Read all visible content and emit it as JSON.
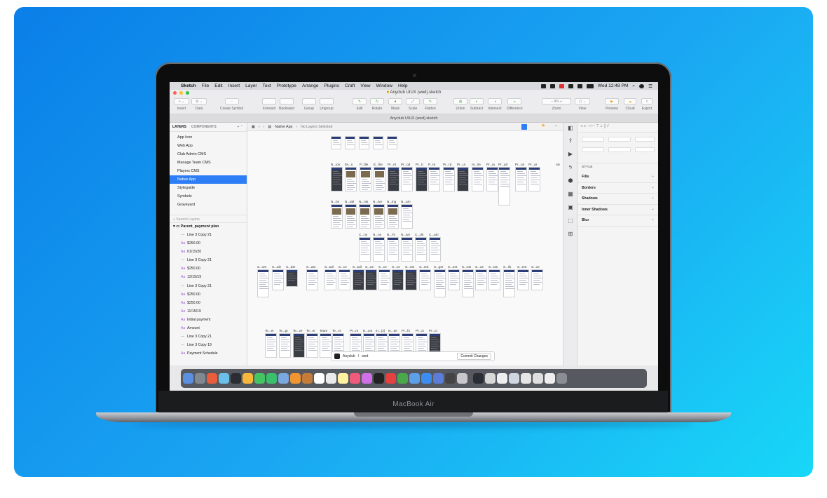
{
  "device": {
    "label": "MacBook Air"
  },
  "menubar": {
    "app": "Sketch",
    "items": [
      "File",
      "Edit",
      "Insert",
      "Layer",
      "Text",
      "Prototype",
      "Arrange",
      "Plugins",
      "Craft",
      "View",
      "Window",
      "Help"
    ],
    "clock": "Wed 12:48 PM"
  },
  "window": {
    "title": "Anyclub UIUX (wed).sketch",
    "tab": "Anyclub UIUX (wed).sketch"
  },
  "toolbar": {
    "insert": "Insert",
    "data": "Data",
    "create_symbol": "Create Symbol",
    "forward": "Forward",
    "backward": "Backward",
    "group": "Group",
    "ungroup": "Ungroup",
    "edit": "Edit",
    "rotate": "Rotate",
    "mask": "Mask",
    "scale": "Scale",
    "flatten": "Flatten",
    "union": "Union",
    "subtract": "Subtract",
    "intersect": "Intersect",
    "difference": "Difference",
    "zoom_label": "Zoom",
    "zoom_value": "8%",
    "view": "View",
    "preview": "Preview",
    "cloud": "Cloud",
    "export": "Export"
  },
  "layers_panel": {
    "tab_layers": "LAYERS",
    "tab_components": "COMPONENTS",
    "pages": [
      "App Icon",
      "Web App",
      "Club Admin CMS",
      "Manage Team CMS",
      "Players CMS",
      "Native App",
      "Styleguide",
      "Symbols",
      "Graveyard"
    ],
    "selected_page": "Native App",
    "search_placeholder": "Search Layers",
    "group_name": "Parent_payment plan",
    "layers": [
      {
        "kind": "line",
        "name": "Line 3 Copy 21"
      },
      {
        "kind": "text",
        "name": "$250.00"
      },
      {
        "kind": "text",
        "name": "01/15/20"
      },
      {
        "kind": "line",
        "name": "Line 3 Copy 21"
      },
      {
        "kind": "text",
        "name": "$250.00"
      },
      {
        "kind": "text",
        "name": "12/15/19"
      },
      {
        "kind": "line",
        "name": "Line 3 Copy 21"
      },
      {
        "kind": "text",
        "name": "$250.00"
      },
      {
        "kind": "text",
        "name": "$250.00"
      },
      {
        "kind": "text",
        "name": "11/15/19"
      },
      {
        "kind": "text",
        "name": "Initial payment"
      },
      {
        "kind": "text",
        "name": "Amount"
      },
      {
        "kind": "line",
        "name": "Line 3 Copy 21"
      },
      {
        "kind": "line",
        "name": "Line 3 Copy 19"
      },
      {
        "kind": "text",
        "name": "Payment Schedule"
      }
    ]
  },
  "canvas": {
    "breadcrumb_page": "Native App",
    "breadcrumb_status": "No Layers Selected",
    "row2_labels": [
      "N...ion",
      "Ev...s",
      "P...file",
      "E...file",
      "Pr...nt",
      "Pr...od",
      "Pr...It",
      "P...te",
      "Pr...rd",
      "Pr...ut",
      "At...ile",
      "Pr...ia",
      "Pr...pil",
      "Pr...on",
      "Pr...ar",
      "Ab"
    ],
    "row3_labels": [
      "N...bs",
      "N...tail",
      "N...nts",
      "N...ive",
      "N...ing",
      "N...am"
    ],
    "row4_labels": [
      "C...ns",
      "N...ns",
      "N...Ts",
      "N...ive",
      "C...dit",
      "C...am"
    ],
    "row5_labels": [
      "S...om",
      "S...ule",
      "S...der",
      "S...ast",
      "S...tail",
      "S...ce",
      "S...tail",
      "S...ue",
      "S...ce",
      "S...ce",
      "S...nts",
      "S...ent",
      "S...ger",
      "S...ent",
      "S...nts",
      "S...ue",
      "S...nts",
      "S...ils",
      "S...ent",
      "S...ce"
    ],
    "row6_labels": [
      "Te...er",
      "Te...pt",
      "Te...ve",
      "Te...er",
      "Team",
      "Te...rs",
      "Pr...nt",
      "E...unt",
      "In...(2)",
      "In...ter",
      "Pr...fo",
      "Pr...ct",
      "Pr...ct"
    ]
  },
  "commit_bar": {
    "project": "Anyclub",
    "sep": "/",
    "branch": "wed",
    "button": "Commit Changes"
  },
  "inspector": {
    "style_label": "STYLE",
    "sections": [
      "Fills",
      "Borders",
      "Shadows",
      "Inner Shadows",
      "Blur"
    ]
  },
  "colors": {
    "accent": "#2d7df6",
    "artboard_header": "#2b3e78"
  }
}
